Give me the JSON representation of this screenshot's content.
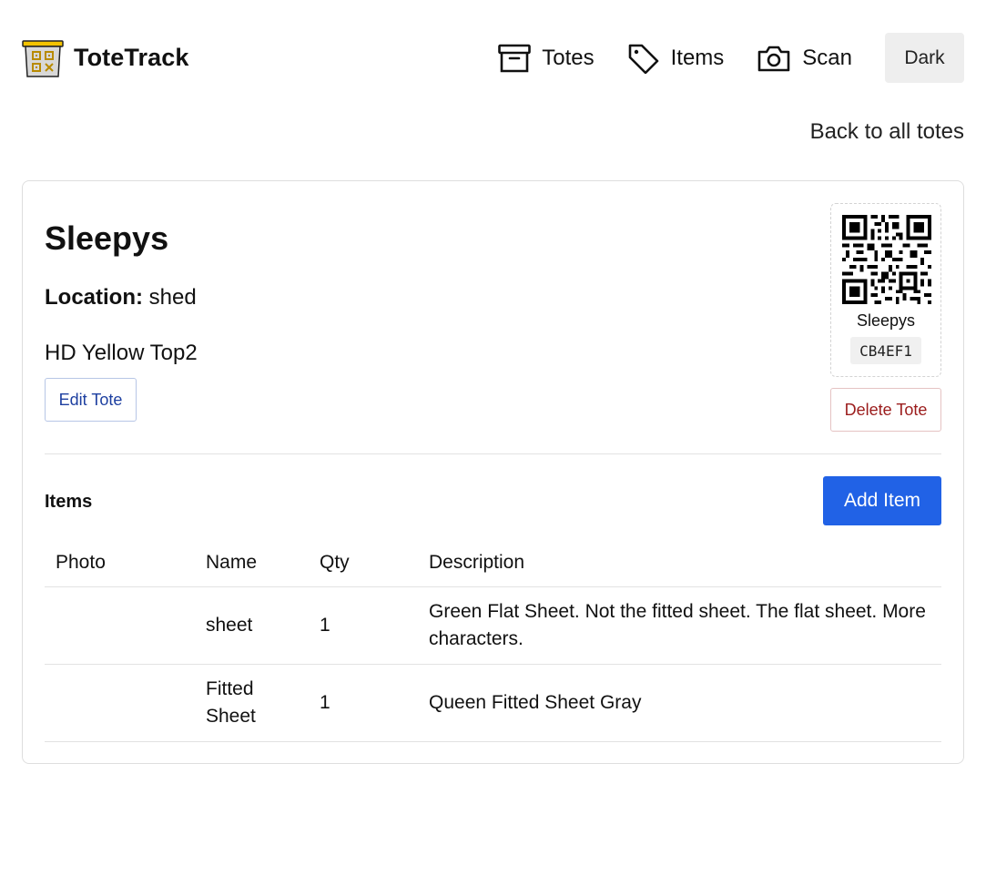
{
  "app": {
    "name": "ToteTrack"
  },
  "nav": {
    "items": [
      {
        "label": "Totes",
        "icon": "archive-box-icon"
      },
      {
        "label": "Items",
        "icon": "tag-icon"
      },
      {
        "label": "Scan",
        "icon": "camera-icon"
      }
    ],
    "theme_toggle": "Dark"
  },
  "back_link": "Back to all totes",
  "tote": {
    "name": "Sleepys",
    "location_label": "Location:",
    "location": "shed",
    "description": "HD Yellow Top2",
    "edit_label": "Edit Tote",
    "delete_label": "Delete Tote",
    "qr_label": "Sleepys",
    "code": "CB4EF1"
  },
  "items_section": {
    "heading": "Items",
    "add_label": "Add Item",
    "columns": [
      "Photo",
      "Name",
      "Qty",
      "Description"
    ],
    "rows": [
      {
        "photo": "",
        "name": "sheet",
        "qty": "1",
        "description": "Green Flat Sheet. Not the fitted sheet. The flat sheet. More characters."
      },
      {
        "photo": "",
        "name": "Fitted Sheet",
        "qty": "1",
        "description": "Queen Fitted Sheet Gray"
      }
    ]
  },
  "colors": {
    "primary": "#2162e6",
    "danger": "#9b1c1c",
    "logo_lid": "#f3c300",
    "border": "#dedede"
  }
}
